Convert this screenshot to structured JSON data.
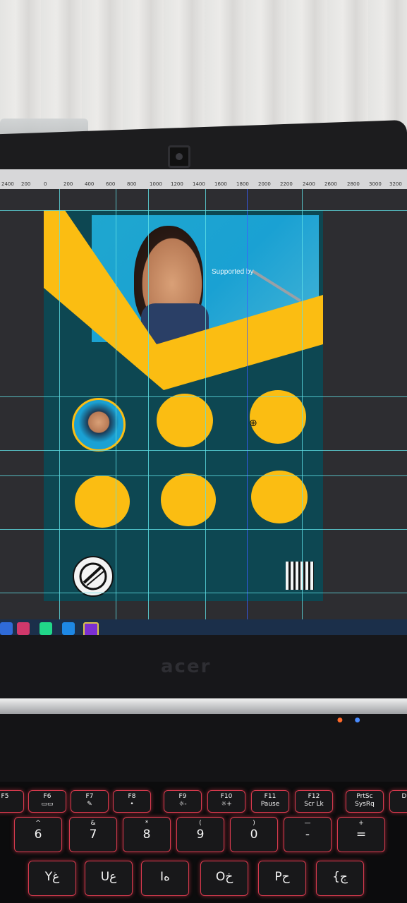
{
  "ruler": {
    "ticks": [
      "2400",
      "200",
      "0",
      "200",
      "400",
      "600",
      "800",
      "1000",
      "1200",
      "1400",
      "1600",
      "1800",
      "2000",
      "2200",
      "2400",
      "2600",
      "2800",
      "3000",
      "3200"
    ]
  },
  "colors": {
    "artboard": "#0d4752",
    "accent_yellow": "#fbbd12",
    "guides": "#5fe0e6",
    "key_backlight": "#d73a4e"
  },
  "screen": {
    "photo_logo_text": "Supported by"
  },
  "laptop": {
    "brand": "acer"
  },
  "keyboard": {
    "function_row": [
      {
        "top": "F5",
        "sub": ""
      },
      {
        "top": "F6",
        "sub": "▭▭"
      },
      {
        "top": "F7",
        "sub": "✎"
      },
      {
        "top": "F8",
        "sub": "•"
      },
      {
        "top": "F9",
        "sub": "☼-"
      },
      {
        "top": "F10",
        "sub": "☼+"
      },
      {
        "top": "F11",
        "sub": "Pause"
      },
      {
        "top": "F12",
        "sub": "Scr Lk"
      },
      {
        "top": "PrtSc",
        "sub": "SysRq"
      },
      {
        "top": "D",
        "sub": ""
      }
    ],
    "number_row": [
      {
        "top": "^",
        "main": "6"
      },
      {
        "top": "&",
        "main": "7"
      },
      {
        "top": "*",
        "main": "8"
      },
      {
        "top": "(",
        "main": "9"
      },
      {
        "top": ")",
        "main": "0"
      },
      {
        "top": "—",
        "main": "-"
      },
      {
        "top": "+",
        "main": "="
      }
    ],
    "letter_row": [
      {
        "main": "Yغ"
      },
      {
        "main": "Uع"
      },
      {
        "main": "Iه"
      },
      {
        "main": "Oخ"
      },
      {
        "main": "Pح"
      },
      {
        "main": "{ج"
      }
    ]
  }
}
